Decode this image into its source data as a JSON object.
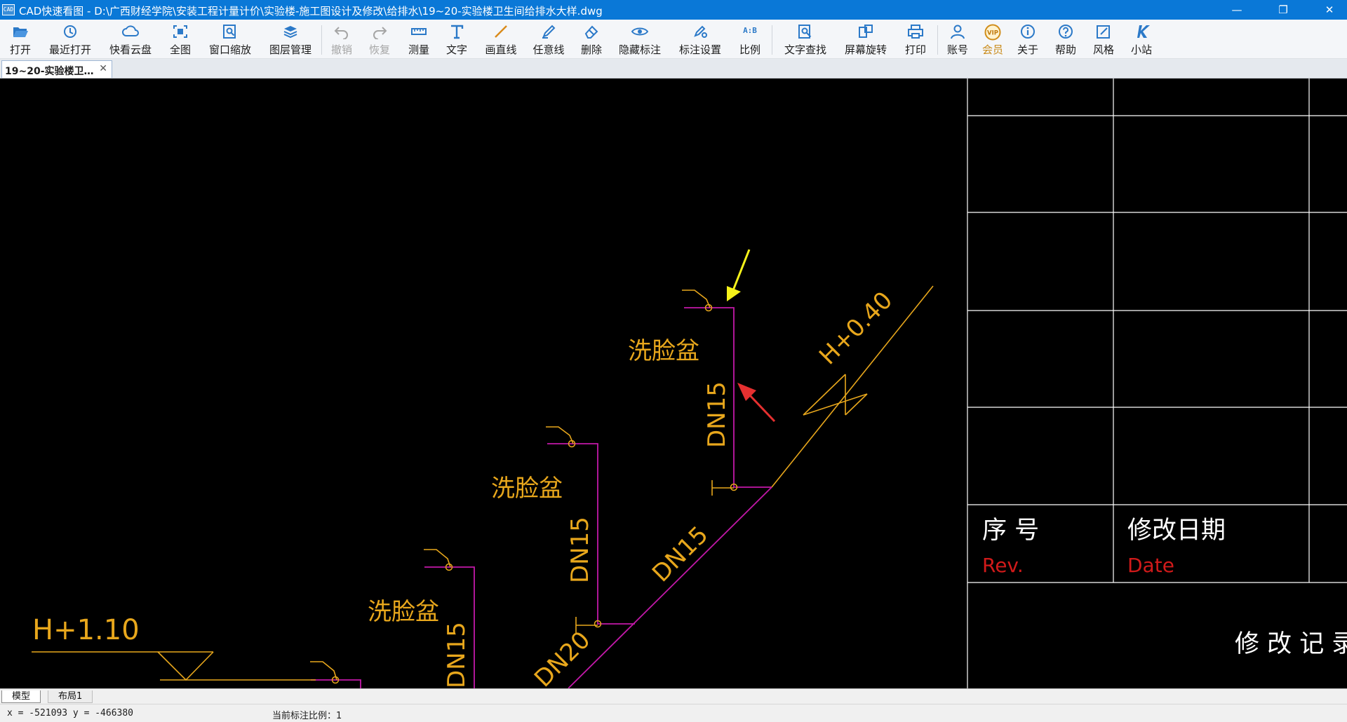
{
  "window": {
    "app_icon_text": "CAD",
    "title": "CAD快速看图 - D:\\广西财经学院\\安装工程计量计价\\实验楼-施工图设计及修改\\给排水\\19~20-实验楼卫生间给排水大样.dwg",
    "minimize": "—",
    "restore": "❐",
    "close": "✕"
  },
  "toolbar": {
    "open": "打开",
    "recent": "最近打开",
    "cloud": "快看云盘",
    "full_view": "全图",
    "window_zoom": "窗口缩放",
    "layers": "图层管理",
    "undo": "撤销",
    "redo": "恢复",
    "measure": "测量",
    "text": "文字",
    "line": "画直线",
    "freeline": "任意线",
    "delete": "删除",
    "hide_mark": "隐藏标注",
    "mark_settings": "标注设置",
    "scale": "比例",
    "text_search": "文字查找",
    "rotate": "屏幕旋转",
    "print": "打印",
    "account": "账号",
    "vip": "会员",
    "about": "关于",
    "help": "帮助",
    "style": "风格",
    "site": "小站",
    "icons": {
      "scale_glyph": "A:B",
      "vip_glyph": "VIP"
    }
  },
  "tabs": {
    "file_tab": "19~20-实验楼卫…",
    "close_glyph": "✕"
  },
  "drawing": {
    "basin_label": "洗脸盆",
    "pipe_dn15": "DN15",
    "pipe_dn20": "DN20",
    "elev_h040": "H+0.40",
    "elev_h110": "H+1.10",
    "title_block": {
      "seq_label": "序  号",
      "date_label": "修改日期",
      "rev_label": "Rev.",
      "date_en": "Date",
      "record_label": "修 改 记 录"
    },
    "colors": {
      "pipe": "#c218a8",
      "annotation": "#e8a71c",
      "title_block_line": "#ffffff",
      "rev_text": "#d11a1a",
      "arrow_yellow": "#f5f21a",
      "arrow_red": "#e53030"
    }
  },
  "layout_tabs": {
    "model": "模型",
    "layout1": "布局1"
  },
  "status": {
    "coords": "x = -521093  y = -466380",
    "scale_label": "当前标注比例：1"
  }
}
